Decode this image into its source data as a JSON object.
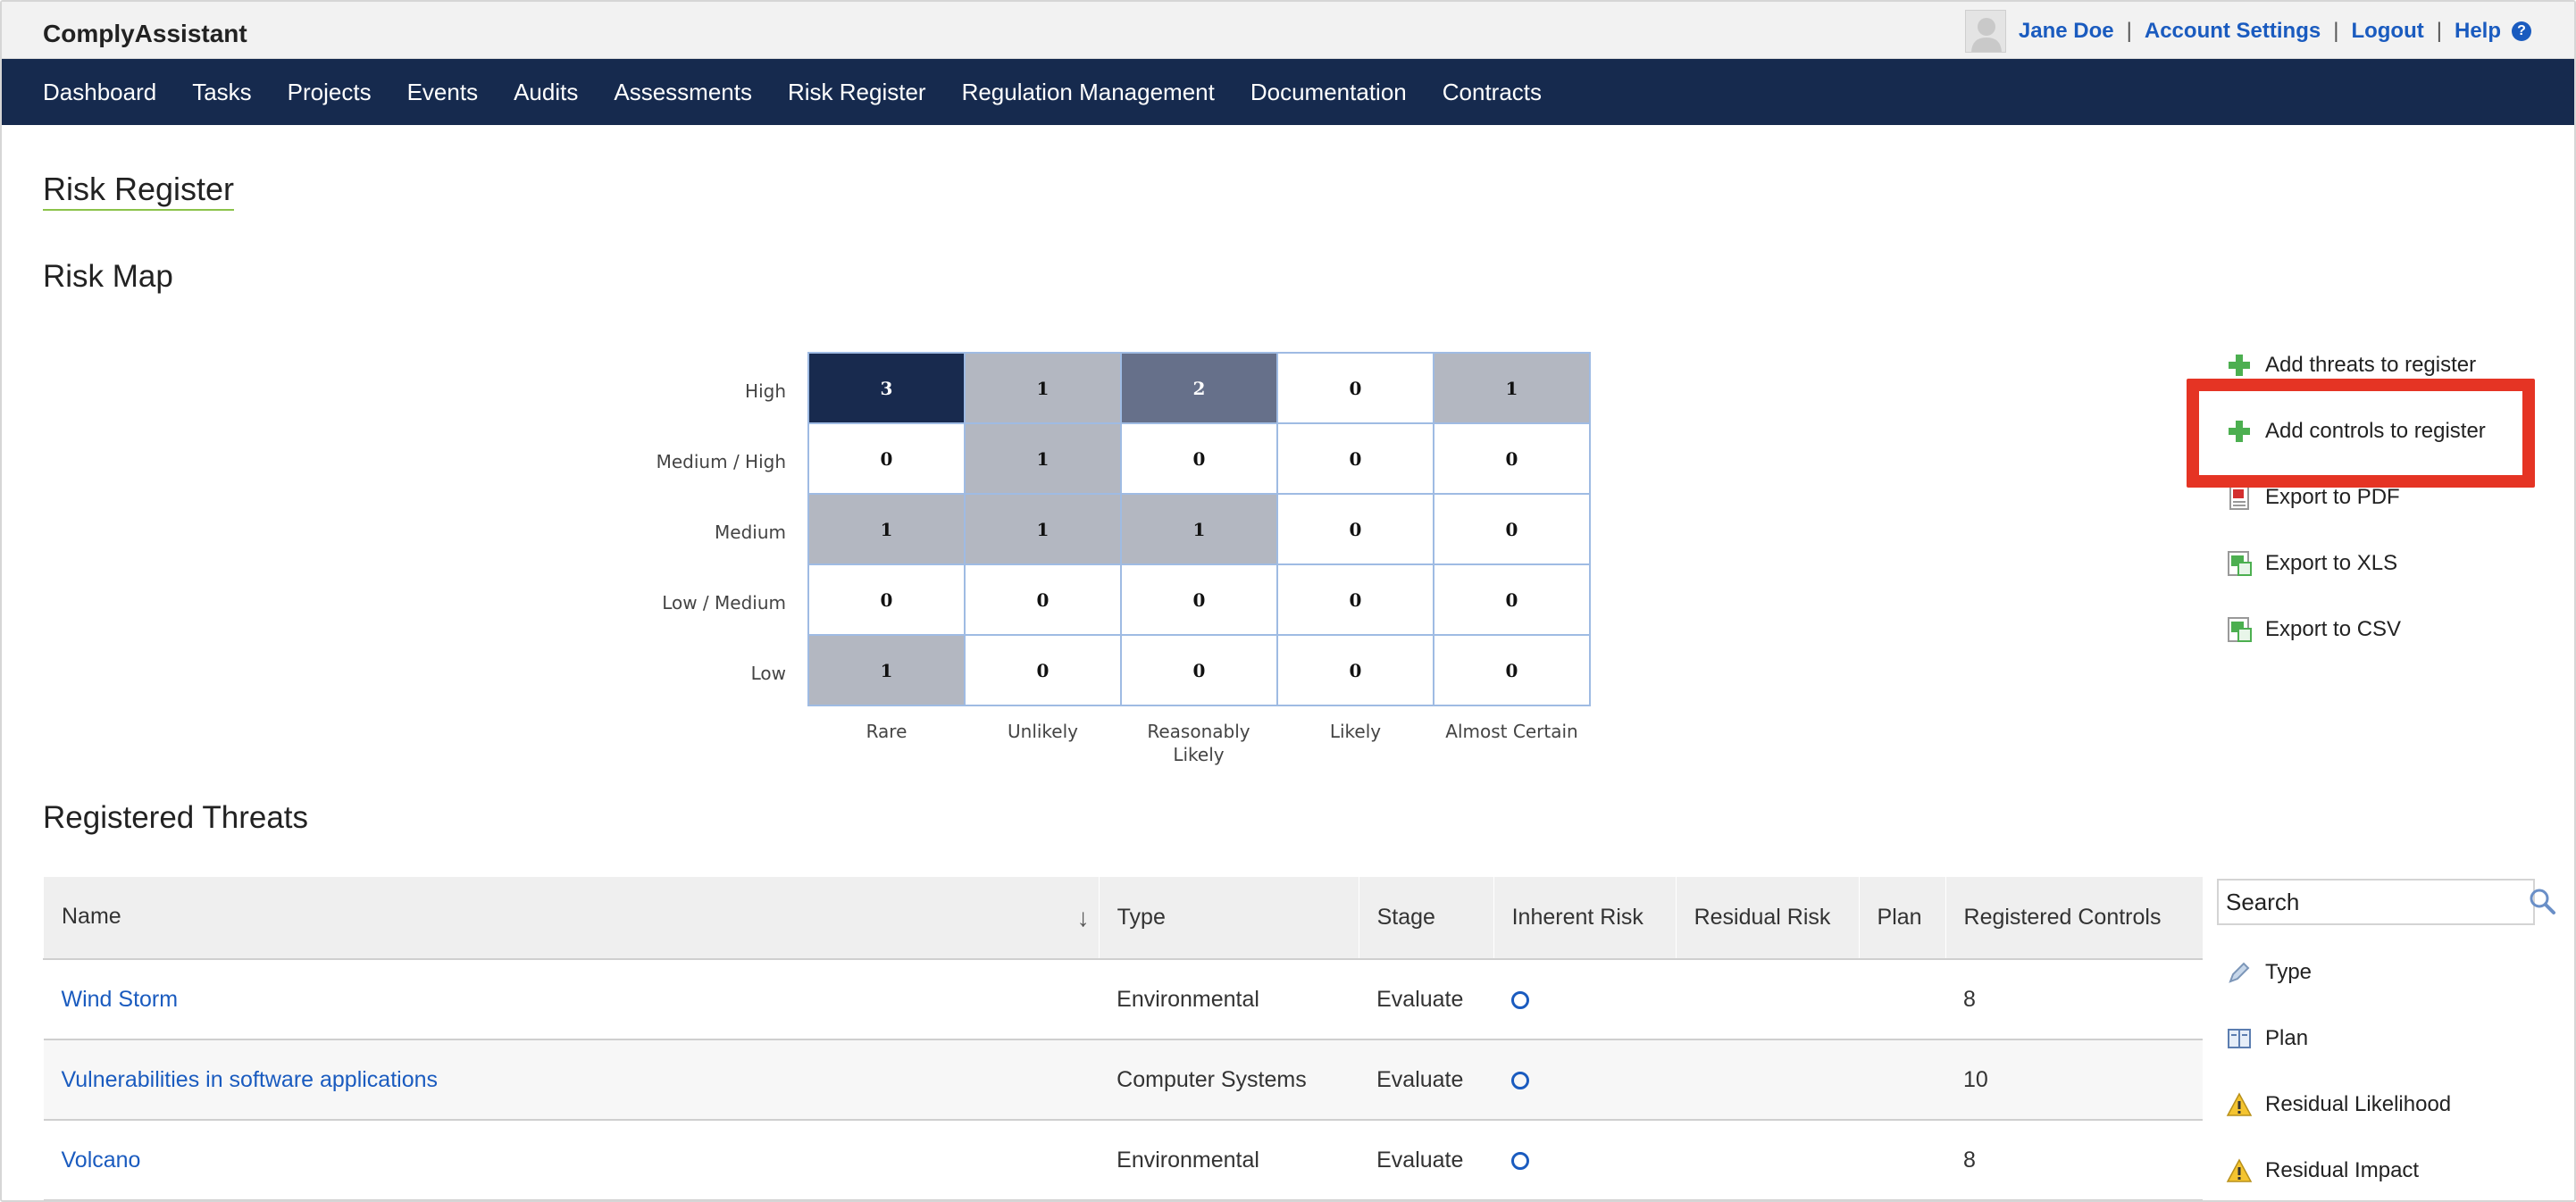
{
  "app": {
    "title": "ComplyAssistant"
  },
  "user": {
    "name": "Jane Doe",
    "links": [
      "Account Settings",
      "Logout",
      "Help"
    ],
    "separator": "|"
  },
  "nav": [
    "Dashboard",
    "Tasks",
    "Projects",
    "Events",
    "Audits",
    "Assessments",
    "Risk Register",
    "Regulation Management",
    "Documentation",
    "Contracts"
  ],
  "page": {
    "title": "Risk Register"
  },
  "risk_map": {
    "title": "Risk Map",
    "impact_labels": [
      "High",
      "Medium / High",
      "Medium",
      "Low / Medium",
      "Low"
    ],
    "likelihood_labels": [
      "Rare",
      "Unlikely",
      "Reasonably Likely",
      "Likely",
      "Almost Certain"
    ],
    "counts": [
      [
        3,
        1,
        2,
        0,
        1
      ],
      [
        0,
        1,
        0,
        0,
        0
      ],
      [
        1,
        1,
        1,
        0,
        0
      ],
      [
        0,
        0,
        0,
        0,
        0
      ],
      [
        1,
        0,
        0,
        0,
        0
      ]
    ],
    "shading": [
      [
        3,
        1,
        2,
        0,
        1
      ],
      [
        0,
        1,
        0,
        0,
        0
      ],
      [
        1,
        1,
        1,
        0,
        0
      ],
      [
        0,
        0,
        0,
        0,
        0
      ],
      [
        1,
        0,
        0,
        0,
        0
      ]
    ],
    "colors": {
      "empty": "#ffffff",
      "low": "#b3b7c1",
      "mid": "#66708a",
      "high": "#182a4e",
      "border": "#9fbbe3"
    }
  },
  "actions": [
    {
      "label": "Add threats to register",
      "icon": "plus-icon"
    },
    {
      "label": "Add controls to register",
      "icon": "plus-icon"
    },
    {
      "label": "Export to PDF",
      "icon": "pdf-icon"
    },
    {
      "label": "Export to XLS",
      "icon": "spreadsheet-icon"
    },
    {
      "label": "Export to CSV",
      "icon": "spreadsheet-icon"
    }
  ],
  "threats": {
    "title": "Registered Threats",
    "columns": [
      "Name",
      "Type",
      "Stage",
      "Inherent Risk",
      "Residual Risk",
      "Plan",
      "Registered Controls"
    ],
    "sort": {
      "column": "Name",
      "direction": "descending"
    },
    "rows": [
      {
        "name": "Wind Storm",
        "type": "Environmental",
        "stage": "Evaluate",
        "inherent_risk": "circle",
        "residual_risk": "",
        "plan": "",
        "controls": "8"
      },
      {
        "name": "Vulnerabilities in software applications",
        "type": "Computer Systems",
        "stage": "Evaluate",
        "inherent_risk": "circle",
        "residual_risk": "",
        "plan": "",
        "controls": "10"
      },
      {
        "name": "Volcano",
        "type": "Environmental",
        "stage": "Evaluate",
        "inherent_risk": "circle",
        "residual_risk": "",
        "plan": "",
        "controls": "8"
      }
    ]
  },
  "search": {
    "placeholder": "Search"
  },
  "filters": [
    {
      "label": "Type",
      "icon": "pencil-icon"
    },
    {
      "label": "Plan",
      "icon": "book-icon"
    },
    {
      "label": "Residual Likelihood",
      "icon": "warning-icon"
    },
    {
      "label": "Residual Impact",
      "icon": "warning-icon"
    }
  ],
  "accent": {
    "link": "#1a5bbf",
    "nav": "#162a4e",
    "highlight": "#e53424",
    "plus": "#4caf50"
  }
}
